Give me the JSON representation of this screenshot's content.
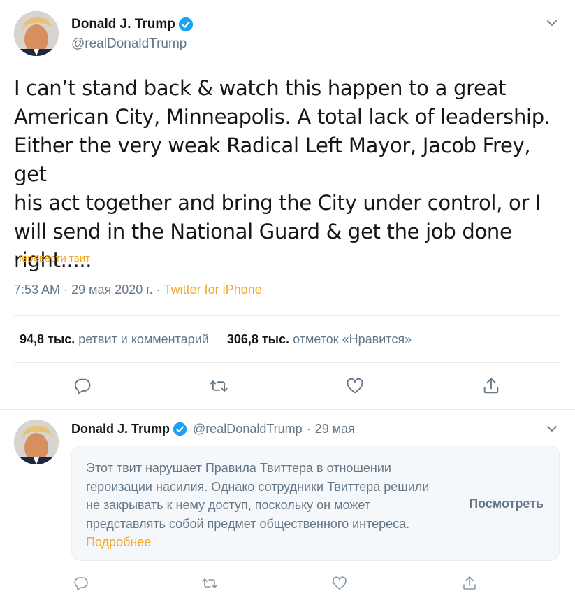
{
  "main_tweet": {
    "author_name": "Donald J. Trump",
    "author_handle": "@realDonaldTrump",
    "text_lines": [
      "I can’t stand back & watch this happen to a great",
      "American City, Minneapolis. A total lack of leadership.",
      "Either the very weak Radical Left Mayor, Jacob Frey, get",
      "his act together and bring the City under control, or I",
      "will send in the National Guard & get the job done",
      "right....."
    ],
    "translate_label": "Перевести твит",
    "time": "7:53 AM",
    "date": "29 мая 2020 г.",
    "separator": "·",
    "meta_separator": " · ",
    "source": "Twitter for iPhone",
    "retweets_count": "94,8 тыс.",
    "retweets_label": "ретвит и комментарий",
    "likes_count": "306,8 тыс.",
    "likes_label": "отметок «Нравится»"
  },
  "second_tweet": {
    "author_name": "Donald J. Trump",
    "author_handle": "@realDonaldTrump",
    "separator": "·",
    "date": "29 мая",
    "notice_text": "Этот твит нарушает Правила Твиттера в отношении героизации насилия. Однако сотрудники Твиттера решили не закрывать к нему доступ, поскольку он может представлять собой предмет общественного интереса.",
    "notice_more": "Подробнее",
    "notice_view_button": "Посмотреть"
  },
  "icons": {
    "verified": "verified-badge-icon",
    "caret": "chevron-down-icon",
    "reply": "reply-icon",
    "retweet": "retweet-icon",
    "like": "heart-icon",
    "share": "share-icon"
  },
  "colors": {
    "accent": "#f5a623",
    "verified": "#1da1f2",
    "secondary_text": "#657786",
    "primary_text": "#14171a",
    "notice_bg": "#f5f8fa"
  }
}
